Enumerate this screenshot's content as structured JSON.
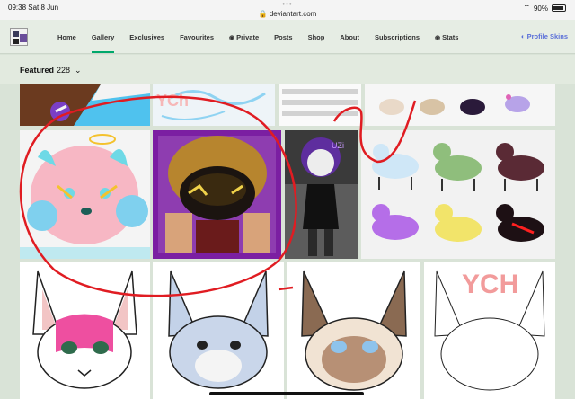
{
  "status": {
    "time": "09:38",
    "date": "Sat 8 Jun",
    "url": "deviantart.com",
    "battery": "90%",
    "dots": "•••"
  },
  "nav": {
    "items": [
      {
        "label": "Home"
      },
      {
        "label": "Gallery"
      },
      {
        "label": "Exclusives"
      },
      {
        "label": "Favourites"
      },
      {
        "label": "Private"
      },
      {
        "label": "Posts"
      },
      {
        "label": "Shop"
      },
      {
        "label": "About"
      },
      {
        "label": "Subscriptions"
      },
      {
        "label": "Stats"
      }
    ],
    "active": "Gallery",
    "profile_skins": "Profile Skins"
  },
  "gallery": {
    "title": "Featured",
    "count": "228"
  },
  "art_text": {
    "ych1": "YCh",
    "uzi": "UZi",
    "ych2": "YCH"
  }
}
